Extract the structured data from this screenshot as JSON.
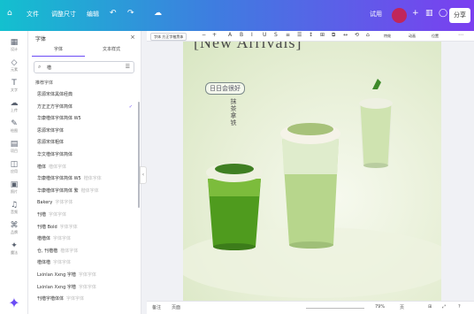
{
  "topbar": {
    "home_label": "⌂",
    "file_label": "文件",
    "resize_label": "调整尺寸",
    "edit_label": "编辑",
    "undo_label": "↶",
    "redo_label": "↷",
    "cloud_label": "☁",
    "upgrade_label": "试用",
    "plus_label": "+",
    "chart_label": "▥",
    "comment_label": "◯",
    "share_label": "分享",
    "colors": {
      "grad_start": "#13c0cf",
      "grad_mid": "#3e7de0",
      "grad_end": "#7b3ff0"
    }
  },
  "navrail": {
    "items": [
      {
        "icon": "▦",
        "label": "设计"
      },
      {
        "icon": "◇",
        "label": "元素"
      },
      {
        "icon": "T",
        "label": "文字"
      },
      {
        "icon": "☁",
        "label": "上传"
      },
      {
        "icon": "✎",
        "label": "绘图"
      },
      {
        "icon": "▤",
        "label": "项目"
      },
      {
        "icon": "◫",
        "label": "应用"
      },
      {
        "icon": "▣",
        "label": "照片"
      },
      {
        "icon": "♫",
        "label": "音频"
      },
      {
        "icon": "⌘",
        "label": "品牌"
      },
      {
        "icon": "✦",
        "label": "魔法"
      }
    ],
    "bottom_icon": "✦"
  },
  "panel": {
    "title": "字体",
    "close": "×",
    "tabs": [
      "字体",
      "文本样式"
    ],
    "search_value": "楷",
    "section_title": "推荐字体",
    "fonts": [
      {
        "name": "思源宋体黑体经典",
        "sub": "",
        "checked": false,
        "expand": false
      },
      {
        "name": "方正正方字体简体",
        "sub": "",
        "checked": true,
        "expand": false
      },
      {
        "name": "华康楷体字体简体 W5",
        "sub": "",
        "checked": false,
        "expand": false
      },
      {
        "name": "思源宋体字体",
        "sub": "",
        "checked": false,
        "expand": false
      },
      {
        "name": "思源宋体粗体",
        "sub": "",
        "checked": false,
        "expand": false
      },
      {
        "name": "华文楷体字体简体",
        "sub": "",
        "checked": false,
        "expand": false
      },
      {
        "name": "楷体",
        "sub": "楷体字体",
        "checked": false,
        "expand": false
      },
      {
        "name": "华康楷体字体简体 W5",
        "sub": "楷体字体",
        "checked": false,
        "expand": false
      },
      {
        "name": "华康楷体字体简体 繁",
        "sub": "楷体字体",
        "checked": false,
        "expand": false
      },
      {
        "name": "Bakery",
        "sub": "字体字体",
        "checked": false,
        "expand": false
      },
      {
        "name": "刊楷",
        "sub": "字体字体",
        "checked": false,
        "expand": false
      },
      {
        "name": "刊楷 Bold",
        "sub": "字体字体",
        "checked": false,
        "expand": false
      },
      {
        "name": "楷楷体",
        "sub": "字体字体",
        "checked": false,
        "expand": true
      },
      {
        "name": "仓, 刊楷楷",
        "sub": "楷体字体",
        "checked": false,
        "expand": true
      },
      {
        "name": "楷体楷",
        "sub": "字体字体",
        "checked": false,
        "expand": false
      },
      {
        "name": "Lxinlan Xxng 字楷",
        "sub": "字体字体",
        "checked": false,
        "expand": false
      },
      {
        "name": "Lxinlan Xxng 字楷",
        "sub": "字体字体",
        "checked": false,
        "expand": false
      },
      {
        "name": "刊楷字楷体体",
        "sub": "字体字体",
        "checked": false,
        "expand": false
      }
    ]
  },
  "toolbar": {
    "font_name": "字体 方正字楷黑体",
    "font_size_minus": "−",
    "font_size_plus": "+",
    "tools": [
      "A",
      "B",
      "I",
      "U",
      "S",
      "≡",
      "☰",
      "↕",
      "⊞",
      "⧉",
      "↔",
      "⟲",
      "⌂"
    ],
    "effects_label": "特效",
    "animate_label": "动画",
    "position_label": "位置",
    "more_label": "⋯"
  },
  "canvas": {
    "headline": "[New Arrivals]",
    "brand_text": "日日会很好",
    "vertical_text": "抹茶拿铁",
    "colors": {
      "bg": "#e7efd6",
      "matcha": "#7fb24a",
      "cream": "#f4f2e6"
    }
  },
  "bottombar": {
    "notes_label": "备注",
    "page_label": "页面",
    "zoom": "79%",
    "pages_label": "页",
    "grid_label": "⊞",
    "full_label": "⤢",
    "help_label": "?"
  }
}
